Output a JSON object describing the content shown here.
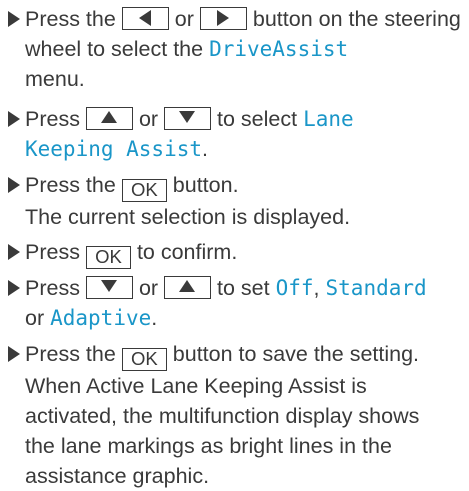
{
  "steps": [
    {
      "p1": "Press the",
      "key1": "left-arrow",
      "p2": "or",
      "key2": "right-arrow",
      "p3": "button on the steering wheel to select the",
      "display1": "DriveAssist",
      "p4": "menu."
    },
    {
      "p1": "Press",
      "key1": "up-arrow",
      "p2": "or",
      "key2": "down-arrow",
      "p3": "to select",
      "display1": "Lane",
      "display2": "Keeping Assist",
      "p4": "."
    },
    {
      "p1": "Press the",
      "ok": "OK",
      "p2": "button.",
      "p3": "The current selection is displayed."
    },
    {
      "p1": "Press",
      "ok": "OK",
      "p2": "to confirm."
    },
    {
      "p1": "Press",
      "key1": "down-arrow",
      "p2": "or",
      "key2": "up-arrow",
      "p3": "to set",
      "display1": "Off",
      "sep1": ",",
      "display2": "Standard",
      "p4": "or",
      "display3": "Adaptive",
      "p5": "."
    },
    {
      "p1": "Press the",
      "ok": "OK",
      "p2": "button to save the setting.",
      "l2": "When Active Lane Keeping Assist is",
      "l3": "activated, the multifunction display shows",
      "l4": "the lane markings as bright lines in the",
      "l5": "assistance graphic."
    }
  ],
  "colors": {
    "text": "#3a3a3a",
    "display_text": "#1a96c8"
  }
}
